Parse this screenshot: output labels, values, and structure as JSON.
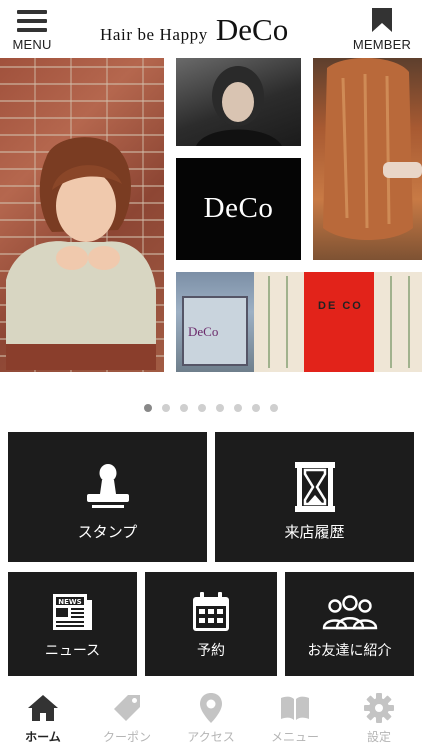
{
  "header": {
    "menu_label": "MENU",
    "logo_tagline": "Hair be Happy",
    "logo_name": "DeCo",
    "member_label": "MEMBER"
  },
  "carousel": {
    "logo_tile_text": "DeCo",
    "shop_sign_text": "DE CO",
    "shop_window_text": "DeCo",
    "page_count": 8,
    "active_page": 1
  },
  "tiles": [
    {
      "label": "スタンプ",
      "icon": "stamp-icon"
    },
    {
      "label": "来店履歴",
      "icon": "hourglass-icon"
    },
    {
      "label": "ニュース",
      "icon": "newspaper-icon"
    },
    {
      "label": "予約",
      "icon": "calendar-icon"
    },
    {
      "label": "お友達に紹介",
      "icon": "people-icon"
    }
  ],
  "tabbar": [
    {
      "label": "ホーム",
      "icon": "home-icon",
      "active": true
    },
    {
      "label": "クーポン",
      "icon": "tag-icon",
      "active": false
    },
    {
      "label": "アクセス",
      "icon": "map-pin-icon",
      "active": false
    },
    {
      "label": "メニュー",
      "icon": "book-icon",
      "active": false
    },
    {
      "label": "設定",
      "icon": "gear-icon",
      "active": false
    }
  ],
  "colors": {
    "tile_bg": "#1c1c1c",
    "tab_active": "#222222",
    "tab_inactive": "#b5b5b5",
    "dot_active": "#888888",
    "dot_inactive": "#cfcfcf"
  }
}
